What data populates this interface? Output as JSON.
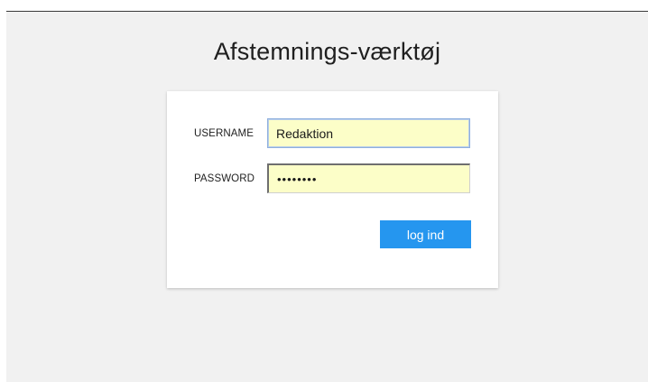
{
  "page": {
    "title": "Afstemnings-værktøj"
  },
  "login_form": {
    "username_label": "USERNAME",
    "username_value": "Redaktion",
    "password_label": "PASSWORD",
    "password_value": "password",
    "submit_label": "log ind"
  },
  "colors": {
    "page_background": "#f1f1f1",
    "card_background": "#ffffff",
    "input_background": "#fcfec8",
    "button_background": "#2596ef",
    "button_text": "#ffffff"
  }
}
